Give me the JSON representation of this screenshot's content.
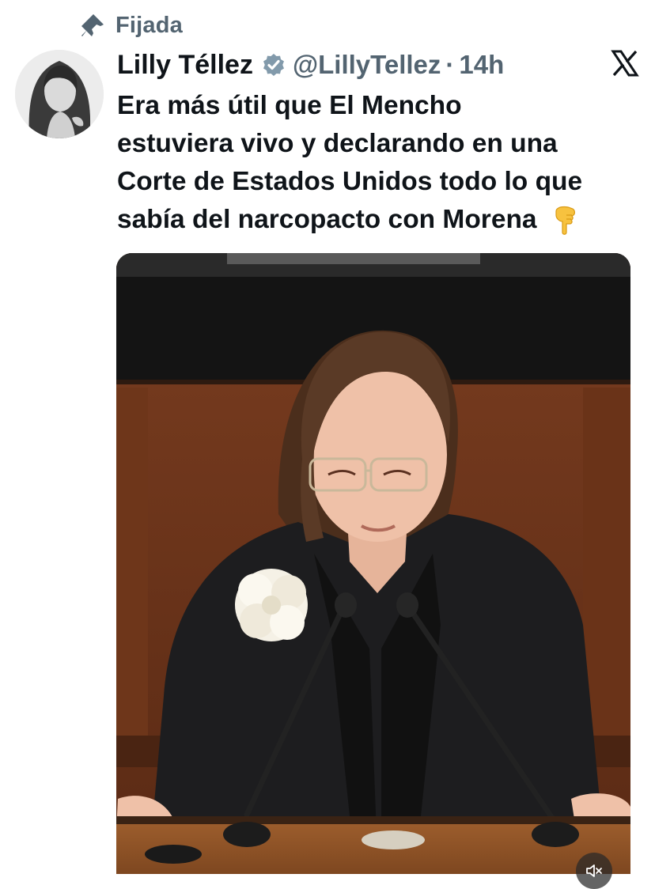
{
  "pinned": {
    "label": "Fijada",
    "icon": "pin-icon"
  },
  "author": {
    "name": "Lilly Téllez",
    "handle": "@LillyTellez",
    "separator": "·",
    "time": "14h",
    "verified": true
  },
  "tweet": {
    "lines": [
      "Era más útil que El Mencho",
      "estuviera vivo y declarando en una",
      "Corte de Estados Unidos todo lo que",
      "sabía del narcopacto con Morena"
    ],
    "emoji": "pointing-down-hand"
  },
  "media": {
    "type": "video",
    "muted": true
  },
  "colors": {
    "text": "#0f1419",
    "secondary": "#536471",
    "verified_badge": "#829aab"
  }
}
